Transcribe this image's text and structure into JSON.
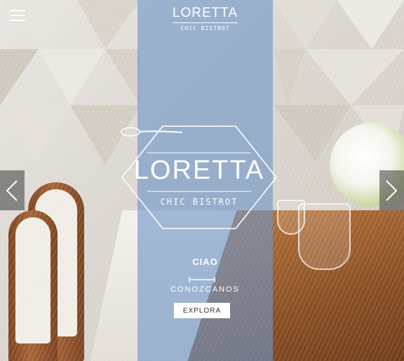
{
  "header": {
    "menu_icon": "hamburger-menu-icon",
    "logo_name": "LORETTA",
    "logo_sub": "CHIC BISTROT"
  },
  "hero": {
    "badge_title": "LORETTA",
    "badge_subtitle": "CHIC BISTROT",
    "greeting": "CIAO",
    "subheading": "CONOZCANOS",
    "cta_label": "EXPLORA",
    "panel_color": "#6e96c8"
  },
  "carousel": {
    "prev_icon": "chevron-left-icon",
    "next_icon": "chevron-right-icon"
  }
}
